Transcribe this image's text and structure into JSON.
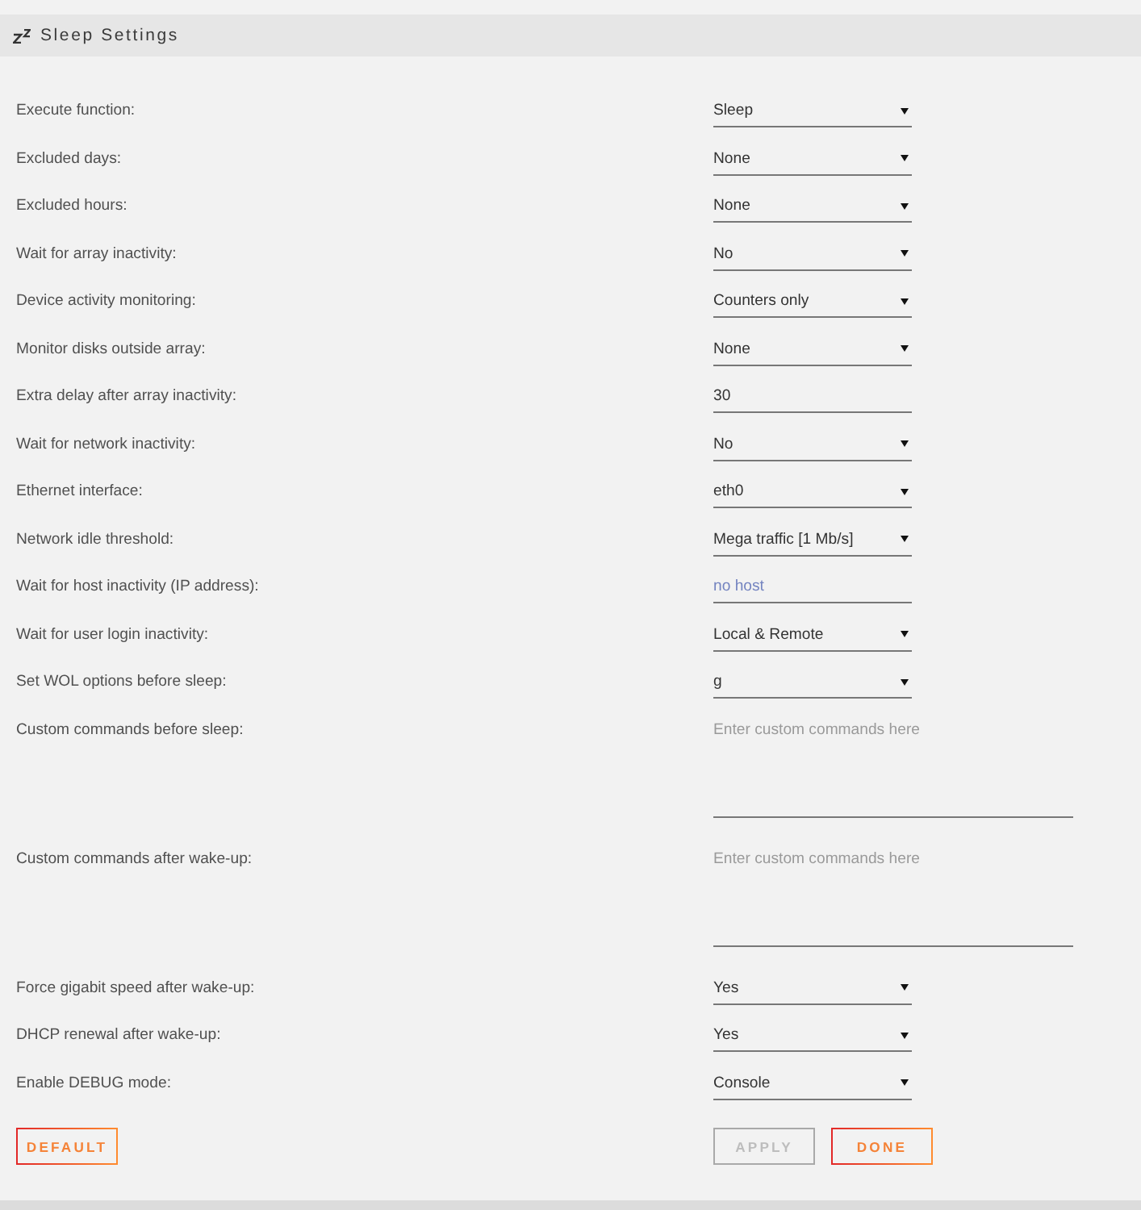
{
  "panel": {
    "title": "Sleep Settings"
  },
  "settings": [
    {
      "label": "Execute function:",
      "kind": "select",
      "value": "Sleep"
    },
    {
      "label": "Excluded days:",
      "kind": "select",
      "value": "None"
    },
    {
      "label": "Excluded hours:",
      "kind": "select",
      "value": "None"
    },
    {
      "label": "Wait for array inactivity:",
      "kind": "select",
      "value": "No"
    },
    {
      "label": "Device activity monitoring:",
      "kind": "select",
      "value": "Counters only"
    },
    {
      "label": "Monitor disks outside array:",
      "kind": "select",
      "value": "None"
    },
    {
      "label": "Extra delay after array inactivity:",
      "kind": "text",
      "value": "30"
    },
    {
      "label": "Wait for network inactivity:",
      "kind": "select",
      "value": "No"
    },
    {
      "label": "Ethernet interface:",
      "kind": "select",
      "value": "eth0"
    },
    {
      "label": "Network idle threshold:",
      "kind": "select",
      "value": "Mega traffic [1 Mb/s]"
    },
    {
      "label": "Wait for host inactivity (IP address):",
      "kind": "text",
      "placeholder": "no host"
    },
    {
      "label": "Wait for user login inactivity:",
      "kind": "select",
      "value": "Local & Remote"
    },
    {
      "label": "Set WOL options before sleep:",
      "kind": "select",
      "value": "g"
    },
    {
      "label": "Custom commands before sleep:",
      "kind": "textarea",
      "placeholder": "Enter custom commands here"
    },
    {
      "label": "Custom commands after wake-up:",
      "kind": "textarea",
      "placeholder": "Enter custom commands here"
    },
    {
      "label": "Force gigabit speed after wake-up:",
      "kind": "select",
      "value": "Yes"
    },
    {
      "label": "DHCP renewal after wake-up:",
      "kind": "select",
      "value": "Yes"
    },
    {
      "label": "Enable DEBUG mode:",
      "kind": "select",
      "value": "Console"
    }
  ],
  "buttons": {
    "left": [
      {
        "label": "DEFAULT",
        "disabled": false
      }
    ],
    "right": [
      {
        "label": "APPLY",
        "disabled": true
      },
      {
        "label": "DONE",
        "disabled": false
      }
    ]
  }
}
